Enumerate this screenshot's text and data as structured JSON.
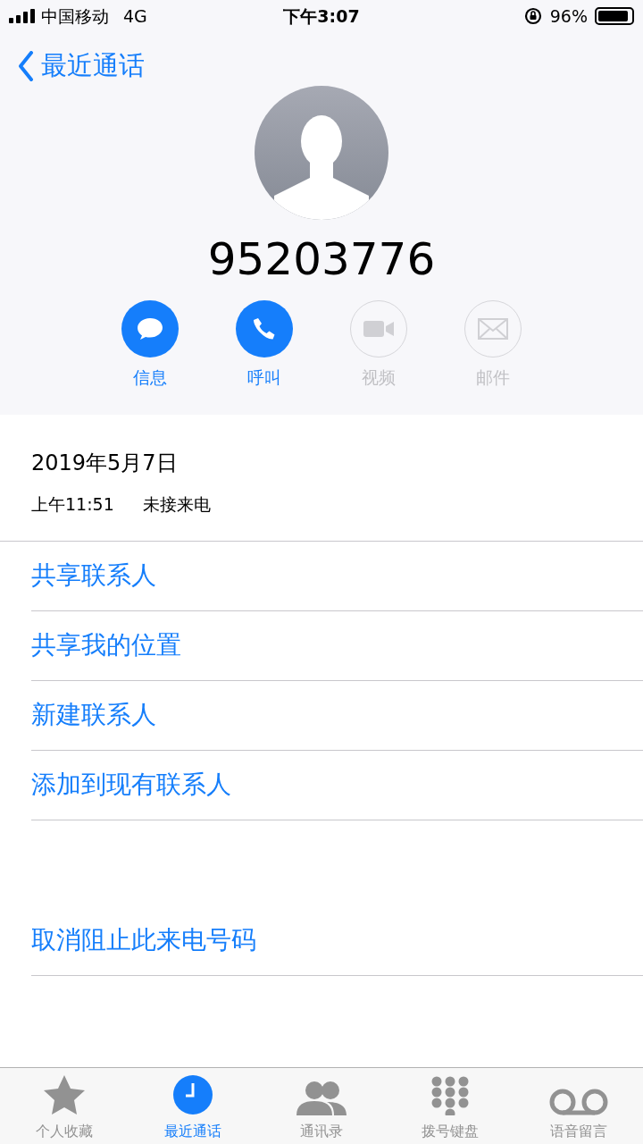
{
  "status_bar": {
    "carrier": "中国移动",
    "network": "4G",
    "time": "下午3:07",
    "battery": "96%"
  },
  "nav": {
    "back": "最近通话"
  },
  "contact": {
    "number": "95203776"
  },
  "actions": [
    {
      "kind": "message",
      "label": "信息",
      "disabled": false
    },
    {
      "kind": "call",
      "label": "呼叫",
      "disabled": false
    },
    {
      "kind": "video",
      "label": "视频",
      "disabled": true
    },
    {
      "kind": "mail",
      "label": "邮件",
      "disabled": true
    }
  ],
  "call_log": {
    "date": "2019年5月7日",
    "time": "上午11:51",
    "type": "未接来电"
  },
  "options": [
    "共享联系人",
    "共享我的位置",
    "新建联系人",
    "添加到现有联系人"
  ],
  "block_option": "取消阻止此来电号码",
  "tabs": [
    {
      "kind": "favorites",
      "label": "个人收藏",
      "selected": false
    },
    {
      "kind": "recents",
      "label": "最近通话",
      "selected": true
    },
    {
      "kind": "contacts",
      "label": "通讯录",
      "selected": false
    },
    {
      "kind": "keypad",
      "label": "拨号键盘",
      "selected": false
    },
    {
      "kind": "voicemail",
      "label": "语音留言",
      "selected": false
    }
  ]
}
